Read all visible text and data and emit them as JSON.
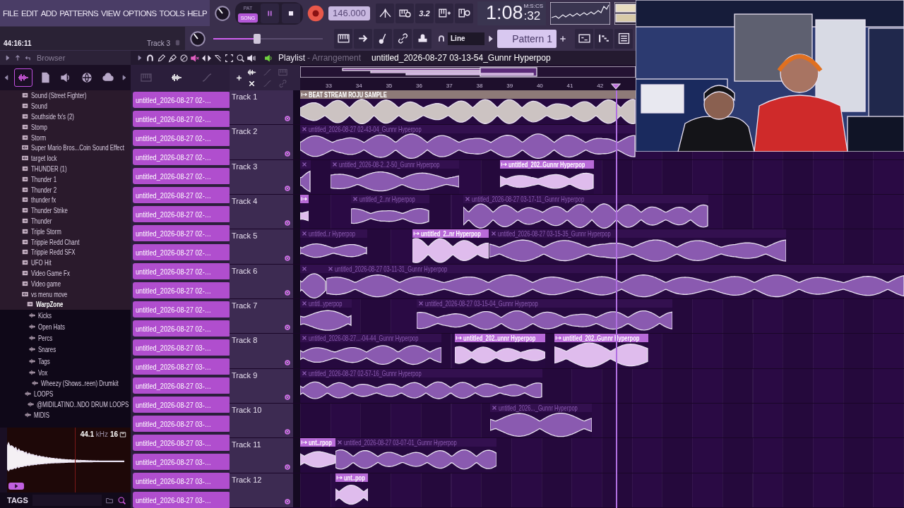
{
  "menu": [
    "FILE",
    "EDIT",
    "ADD",
    "PATTERNS",
    "VIEW",
    "OPTIONS",
    "TOOLS",
    "HELP"
  ],
  "transport": {
    "modes": [
      {
        "label": "PAT",
        "selected": false
      },
      {
        "label": "SONG",
        "selected": true
      }
    ],
    "tempo": "146.000",
    "typing_label": "3.2",
    "time_main": "1:08",
    "time_small": ":32",
    "time_format": "M:S:CS"
  },
  "hint": {
    "time": "44:16:11",
    "target": "Track 3"
  },
  "master_pitch": {
    "level": 0.4
  },
  "snap": "Line",
  "pattern": "Pattern 1",
  "browser": {
    "title": "Browser",
    "items": [
      {
        "label": "Sound (Street Fighter)",
        "kind": "folder"
      },
      {
        "label": "Sound",
        "kind": "folder"
      },
      {
        "label": "Southside fx's (2)",
        "kind": "folder"
      },
      {
        "label": "Stomp",
        "kind": "folder"
      },
      {
        "label": "Storm",
        "kind": "folder"
      },
      {
        "label": "Super Mario Bros...Coin Sound Effect",
        "kind": "file"
      },
      {
        "label": "target lock",
        "kind": "file"
      },
      {
        "label": "THUNDER (1)",
        "kind": "folder"
      },
      {
        "label": "Thunder 1",
        "kind": "folder"
      },
      {
        "label": "Thunder 2",
        "kind": "folder"
      },
      {
        "label": "thunder fx",
        "kind": "folder"
      },
      {
        "label": "Thunder Strike",
        "kind": "folder"
      },
      {
        "label": "Thunder",
        "kind": "folder"
      },
      {
        "label": "Triple Storm",
        "kind": "folder"
      },
      {
        "label": "Trippie Redd Chant",
        "kind": "folder"
      },
      {
        "label": "Trippie Redd SFX",
        "kind": "folder"
      },
      {
        "label": "UFO Hit",
        "kind": "folder"
      },
      {
        "label": "Video Game Fx",
        "kind": "folder"
      },
      {
        "label": "Video game",
        "kind": "folder"
      },
      {
        "label": "vs menu move",
        "kind": "file"
      },
      {
        "label": "WarpZone",
        "kind": "folder",
        "expanded": true,
        "children": [
          {
            "label": "Kicks",
            "kind": "kit"
          },
          {
            "label": "Open Hats",
            "kind": "kit"
          },
          {
            "label": "Percs",
            "kind": "kit"
          },
          {
            "label": "Snares",
            "kind": "kit"
          },
          {
            "label": "Tags",
            "kind": "kit"
          },
          {
            "label": "Vox",
            "kind": "kit"
          }
        ]
      },
      {
        "label": "Wheezy (Shows..reen)  Drumkit",
        "kind": "kit"
      },
      {
        "label": "LOOPS",
        "kind": "kit"
      },
      {
        "label": "@MIDILATINO..NDO DRUM LOOPS",
        "kind": "kit"
      },
      {
        "label": "MIDIS",
        "kind": "kit"
      }
    ],
    "sample_info": "**44.1** kHz **16**",
    "tags_label": "TAGS"
  },
  "playlist": {
    "title": "Playlist",
    "mode": "- Arrangement",
    "song": "untitled_2026-08-27 03-13-54_Gunnr Hyperpop",
    "clip_sources": [
      "untitled_2026-08-27 02-…",
      "untitled_2026-08-27 02-…",
      "untitled_2026-08-27 02-…",
      "untitled_2026-08-27 02-…",
      "untitled_2026-08-27 02-…",
      "untitled_2026-08-27 02-…",
      "untitled_2026-08-27 02-…",
      "untitled_2026-08-27 02-…",
      "untitled_2026-08-27 02-…",
      "untitled_2026-08-27 02-…",
      "untitled_2026-08-27 02-…",
      "untitled_2026-08-27 02-…",
      "untitled_2026-08-27 02-…",
      "untitled_2026-08-27 03-…",
      "untitled_2026-08-27 03-…",
      "untitled_2026-08-27 03-…",
      "untitled_2026-08-27 03-…",
      "untitled_2026-08-27 03-…",
      "untitled_2026-08-27 03-…",
      "untitled_2026-08-27 03-…",
      "untitled_2026-08-27 03-…",
      "untitled_2026-08-27 03-…"
    ],
    "ruler": [
      "33",
      "34",
      "35",
      "36",
      "37",
      "38",
      "39",
      "40",
      "41",
      "42"
    ],
    "tracks": [
      {
        "name": "Track 1",
        "clips": [
          {
            "label": "BEAT STREAM ROJU SAMPLE",
            "muted": false,
            "color": "#8e7a78"
          }
        ]
      },
      {
        "name": "Track 2",
        "clips": [
          {
            "label": "untitled_2026-08-27 02-43-04_Gunnr Hyperpop",
            "muted": true,
            "color": "#8a5ab0"
          }
        ]
      },
      {
        "name": "Track 3",
        "clips": [
          {
            "muted": true,
            "color": "#8a5ab0"
          },
          {
            "label": "untitled_2026-08-2..2-50_Gunnr Hyperpop",
            "muted": true,
            "color": "#8a5ab0"
          },
          {
            "label": "untitled_202..Gunnr Hyperpop",
            "muted": false,
            "color": "#b86ad8"
          }
        ]
      },
      {
        "name": "Track 4",
        "clips": [
          {
            "muted": false,
            "color": "#b86ad8"
          },
          {
            "label": "untitled_2..nr Hyperpop",
            "muted": true,
            "color": "#8a5ab0"
          },
          {
            "label": "untitled_2026-08-27 03-17-11_Gunnr Hyperpop",
            "muted": true,
            "color": "#8a5ab0"
          }
        ]
      },
      {
        "name": "Track 5",
        "clips": [
          {
            "label": "untitled..r Hyperpop",
            "muted": true,
            "color": "#8a5ab0"
          },
          {
            "label": "untitled_2..nr Hyperpop",
            "muted": false,
            "color": "#b86ad8"
          },
          {
            "label": "untitled_2026-08-27 03-15-35_Gunnr Hyperpop",
            "muted": true,
            "color": "#8a5ab0"
          }
        ]
      },
      {
        "name": "Track 6",
        "clips": [
          {
            "muted": true,
            "color": "#8a5ab0"
          },
          {
            "label": "untitled_2026-08-27 03-11-31_Gunnr Hyperpop",
            "muted": true,
            "color": "#8a5ab0"
          }
        ]
      },
      {
        "name": "Track 7",
        "clips": [
          {
            "label": "untitl..yperpop",
            "muted": true,
            "color": "#8a5ab0"
          },
          {
            "label": "untitled_2026-08-27 03-15-04_Gunnr Hyperpop",
            "muted": true,
            "color": "#8a5ab0"
          }
        ]
      },
      {
        "name": "Track 8",
        "clips": [
          {
            "label": "untitled_2026-08-27...-04-44_Gunnr Hyperpop",
            "muted": true,
            "color": "#8a5ab0"
          },
          {
            "label": "untitled_202..unnr Hyperpop",
            "muted": false,
            "color": "#b86ad8"
          },
          {
            "label": "untitled_202..Gunnr Hyperpop",
            "muted": false,
            "color": "#b86ad8"
          }
        ]
      },
      {
        "name": "Track 9",
        "clips": [
          {
            "label": "untitled_2026-08-27 02-57-16_Gunnr Hyperpop",
            "muted": true,
            "color": "#8a5ab0"
          }
        ]
      },
      {
        "name": "Track 10",
        "clips": [
          {
            "label": "untitled_2026..._Gunnr Hyperpop",
            "muted": true,
            "color": "#8a5ab0"
          }
        ]
      },
      {
        "name": "Track 11",
        "clips": [
          {
            "label": "unt..rpop",
            "muted": false,
            "color": "#b86ad8"
          },
          {
            "label": "untitled_2026-08-27 03-07-01_Gunnr Hyperpop",
            "muted": true,
            "color": "#8a5ab0"
          }
        ]
      },
      {
        "name": "Track 12",
        "clips": [
          {
            "label": "unt..pop",
            "muted": false,
            "color": "#b86ad8"
          }
        ]
      }
    ]
  }
}
